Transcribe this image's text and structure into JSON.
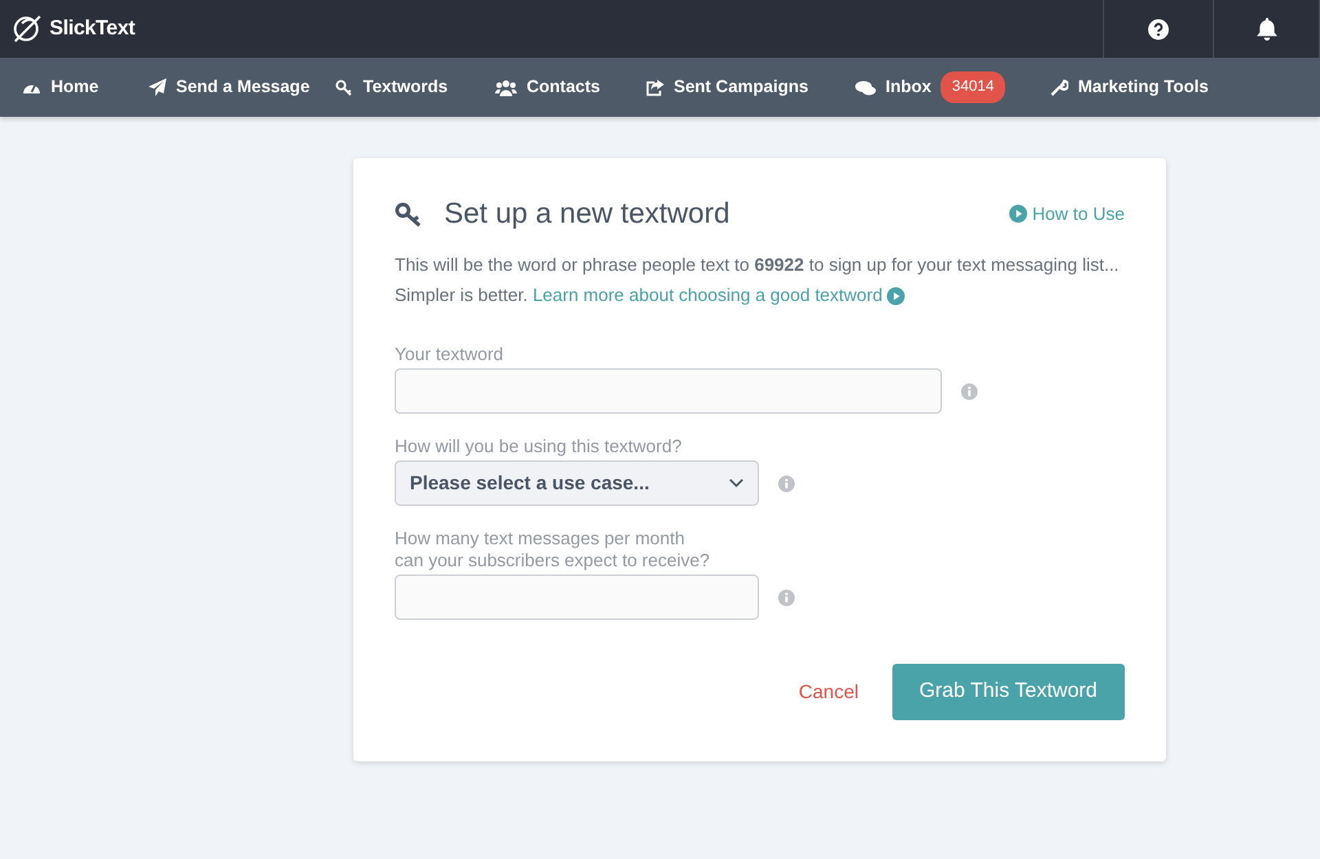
{
  "brand": {
    "name": "SlickText"
  },
  "nav": [
    {
      "label": "Home"
    },
    {
      "label": "Send a Message"
    },
    {
      "label": "Textwords"
    },
    {
      "label": "Contacts"
    },
    {
      "label": "Sent Campaigns"
    },
    {
      "label": "Inbox",
      "badge": "34014"
    },
    {
      "label": "Marketing Tools"
    }
  ],
  "card": {
    "title": "Set up a new textword",
    "help_link": "How to Use",
    "description": "This will be the word or phrase people text to **69922** to sign up for your text messaging list... Simpler is better.",
    "description_link": "Learn more about choosing a good textword",
    "fields": [
      {
        "kind": "text",
        "label": "Your textword",
        "wide": true
      },
      {
        "kind": "select",
        "label": "How will you be using this textword?",
        "value": "Please select a use case...",
        "wide": false
      },
      {
        "kind": "text",
        "label": "How many text messages per month\ncan your subscribers expect to receive?",
        "wide": false
      }
    ],
    "cancel": "Cancel",
    "submit": "Grab This Textword"
  }
}
